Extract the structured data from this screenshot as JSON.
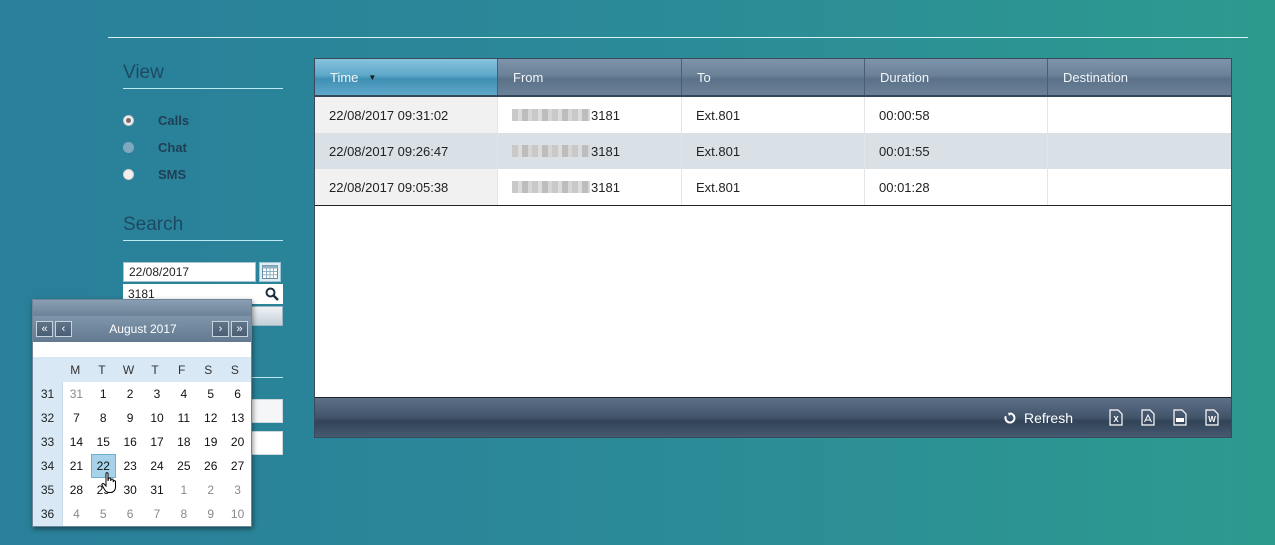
{
  "sidebar": {
    "view_title": "View",
    "view_options": [
      {
        "label": "Calls",
        "state": "checked"
      },
      {
        "label": "Chat",
        "state": "disabled"
      },
      {
        "label": "SMS",
        "state": "unchecked"
      }
    ],
    "search_title": "Search",
    "date_value": "22/08/2017",
    "search_value": "3181"
  },
  "calendar": {
    "month_label": "August 2017",
    "nav": {
      "prev_year": "«",
      "prev": "‹",
      "next": "›",
      "next_year": "»"
    },
    "weekdays": [
      "M",
      "T",
      "W",
      "T",
      "F",
      "S",
      "S"
    ],
    "weeks": [
      "31",
      "32",
      "33",
      "34",
      "35",
      "36"
    ],
    "days": [
      [
        "31",
        "1",
        "2",
        "3",
        "4",
        "5",
        "6"
      ],
      [
        "7",
        "8",
        "9",
        "10",
        "11",
        "12",
        "13"
      ],
      [
        "14",
        "15",
        "16",
        "17",
        "18",
        "19",
        "20"
      ],
      [
        "21",
        "22",
        "23",
        "24",
        "25",
        "26",
        "27"
      ],
      [
        "28",
        "29",
        "30",
        "31",
        "1",
        "2",
        "3"
      ],
      [
        "4",
        "5",
        "6",
        "7",
        "8",
        "9",
        "10"
      ]
    ],
    "selected_day": "22"
  },
  "grid": {
    "columns": [
      "Time",
      "From",
      "To",
      "Duration",
      "Destination"
    ],
    "sorted_column": "Time",
    "rows": [
      {
        "time": "22/08/2017 09:31:02",
        "from_suffix": "3181",
        "to": "Ext.801",
        "duration": "00:00:58",
        "destination": ""
      },
      {
        "time": "22/08/2017 09:26:47",
        "from_suffix": "3181",
        "to": "Ext.801",
        "duration": "00:01:55",
        "destination": ""
      },
      {
        "time": "22/08/2017 09:05:38",
        "from_suffix": "3181",
        "to": "Ext.801",
        "duration": "00:01:28",
        "destination": ""
      }
    ],
    "footer": {
      "refresh_label": "Refresh",
      "exports": [
        "export-excel-icon",
        "export-pdf-icon",
        "export-csv-icon",
        "export-word-icon"
      ]
    }
  }
}
